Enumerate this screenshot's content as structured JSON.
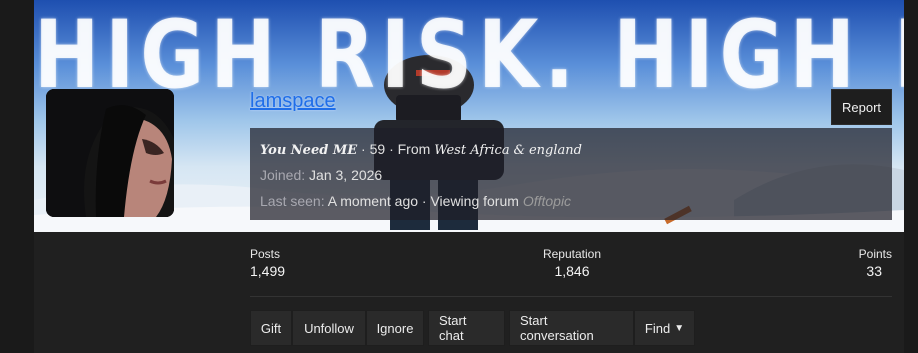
{
  "banner": {
    "title": "HIGH RISK. HIGH REWARD"
  },
  "profile": {
    "username": "lamspace",
    "report_label": "Report",
    "user_title": "You Need ME",
    "age": "59",
    "from_prefix": "From",
    "location_fancy": "West Africa",
    "location_amp": "&",
    "location_extra": "england",
    "joined_label": "Joined:",
    "joined_value": "Jan 3, 2026",
    "last_seen_label": "Last seen:",
    "last_seen_value": "A moment ago",
    "activity": "Viewing forum",
    "activity_forum": "Offtopic"
  },
  "stats": {
    "posts_label": "Posts",
    "posts_value": "1,499",
    "reputation_label": "Reputation",
    "reputation_value": "1,846",
    "points_label": "Points",
    "points_value": "33"
  },
  "actions": {
    "gift": "Gift",
    "unfollow": "Unfollow",
    "ignore": "Ignore",
    "start_chat": "Start chat",
    "start_conversation": "Start conversation",
    "find": "Find"
  },
  "colors": {
    "username": "#1f6ee8",
    "background": "#202020"
  }
}
